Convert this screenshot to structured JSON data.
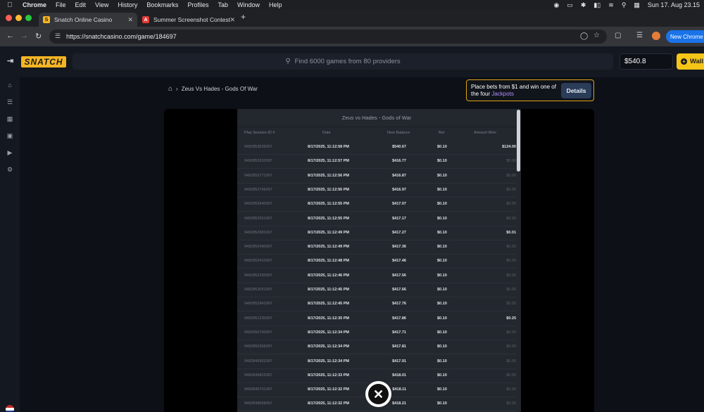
{
  "menubar": {
    "app": "Chrome",
    "items": [
      "File",
      "Edit",
      "View",
      "History",
      "Bookmarks",
      "Profiles",
      "Tab",
      "Window",
      "Help"
    ],
    "clock": "Sun 17. Aug 23.15"
  },
  "tabs": [
    {
      "title": "Snatch Online Casino",
      "fav": "S",
      "fav_color": "#f5b623"
    },
    {
      "title": "Summer Screenshot Contest",
      "fav": "A",
      "fav_color": "#e53935"
    }
  ],
  "address": {
    "url": "https://snatchcasino.com/game/184697"
  },
  "new_chrome_label": "New Chrome",
  "site": {
    "logo": "SNATCH",
    "search_placeholder": "Find 6000 games from 80 providers",
    "balance": "$540.8",
    "wallet_label": "Wall"
  },
  "breadcrumb": {
    "game": "Zeus Vs Hades - Gods Of War"
  },
  "jackpot": {
    "text_a": "Place bets from $1 and win one of the four ",
    "text_b": "Jackpots",
    "button": "Details"
  },
  "history": {
    "title": "Zeus vs Hades - Gods of War",
    "headers": [
      "Play Session ID #",
      "Date",
      "New Balance",
      "Bet",
      "Amount Won"
    ],
    "rows": [
      {
        "id": "9492853639097",
        "date": "8/17/2025, 11:12:58 PM",
        "bal": "$540.67",
        "bet": "$0.10",
        "won": "$124.00"
      },
      {
        "id": "9492853632097",
        "date": "8/17/2025, 11:12:57 PM",
        "bal": "$416.77",
        "bet": "$0.10",
        "won": "$0.00"
      },
      {
        "id": "9492852771097",
        "date": "8/17/2025, 11:12:56 PM",
        "bal": "$416.87",
        "bet": "$0.10",
        "won": "$0.00"
      },
      {
        "id": "9492852766097",
        "date": "8/17/2025, 11:12:56 PM",
        "bal": "$416.97",
        "bet": "$0.10",
        "won": "$0.00"
      },
      {
        "id": "9492852640097",
        "date": "8/17/2025, 11:12:55 PM",
        "bal": "$417.07",
        "bet": "$0.10",
        "won": "$0.00"
      },
      {
        "id": "9492852551097",
        "date": "8/17/2025, 11:12:55 PM",
        "bal": "$417.17",
        "bet": "$0.10",
        "won": "$0.00"
      },
      {
        "id": "9492852581097",
        "date": "8/17/2025, 11:12:49 PM",
        "bal": "$417.27",
        "bet": "$0.10",
        "won": "$0.01"
      },
      {
        "id": "9492852490097",
        "date": "8/17/2025, 11:12:49 PM",
        "bal": "$417.36",
        "bet": "$0.10",
        "won": "$0.00"
      },
      {
        "id": "9492852410097",
        "date": "8/17/2025, 11:12:48 PM",
        "bal": "$417.46",
        "bet": "$0.10",
        "won": "$0.00"
      },
      {
        "id": "9492852330097",
        "date": "8/17/2025, 11:12:46 PM",
        "bal": "$417.56",
        "bet": "$0.10",
        "won": "$0.00"
      },
      {
        "id": "9492852051097",
        "date": "8/17/2025, 11:12:45 PM",
        "bal": "$417.66",
        "bet": "$0.10",
        "won": "$0.00"
      },
      {
        "id": "9492851842097",
        "date": "8/17/2025, 11:12:45 PM",
        "bal": "$417.76",
        "bet": "$0.10",
        "won": "$0.00"
      },
      {
        "id": "9492851230097",
        "date": "8/17/2025, 11:12:35 PM",
        "bal": "$417.86",
        "bet": "$0.10",
        "won": "$0.25"
      },
      {
        "id": "9492850700097",
        "date": "8/17/2025, 11:12:34 PM",
        "bal": "$417.71",
        "bet": "$0.10",
        "won": "$0.00"
      },
      {
        "id": "9492850356097",
        "date": "8/17/2025, 11:12:34 PM",
        "bal": "$417.81",
        "bet": "$0.10",
        "won": "$0.00"
      },
      {
        "id": "9492849952097",
        "date": "8/17/2025, 11:12:34 PM",
        "bal": "$417.91",
        "bet": "$0.10",
        "won": "$0.00"
      },
      {
        "id": "9492849822097",
        "date": "8/17/2025, 11:12:33 PM",
        "bal": "$418.01",
        "bet": "$0.10",
        "won": "$0.00"
      },
      {
        "id": "9492849701097",
        "date": "8/17/2025, 11:12:32 PM",
        "bal": "$418.11",
        "bet": "$0.10",
        "won": "$0.00"
      },
      {
        "id": "9492849668097",
        "date": "8/17/2025, 11:12:32 PM",
        "bal": "$418.21",
        "bet": "$0.10",
        "won": "$0.00"
      }
    ]
  }
}
